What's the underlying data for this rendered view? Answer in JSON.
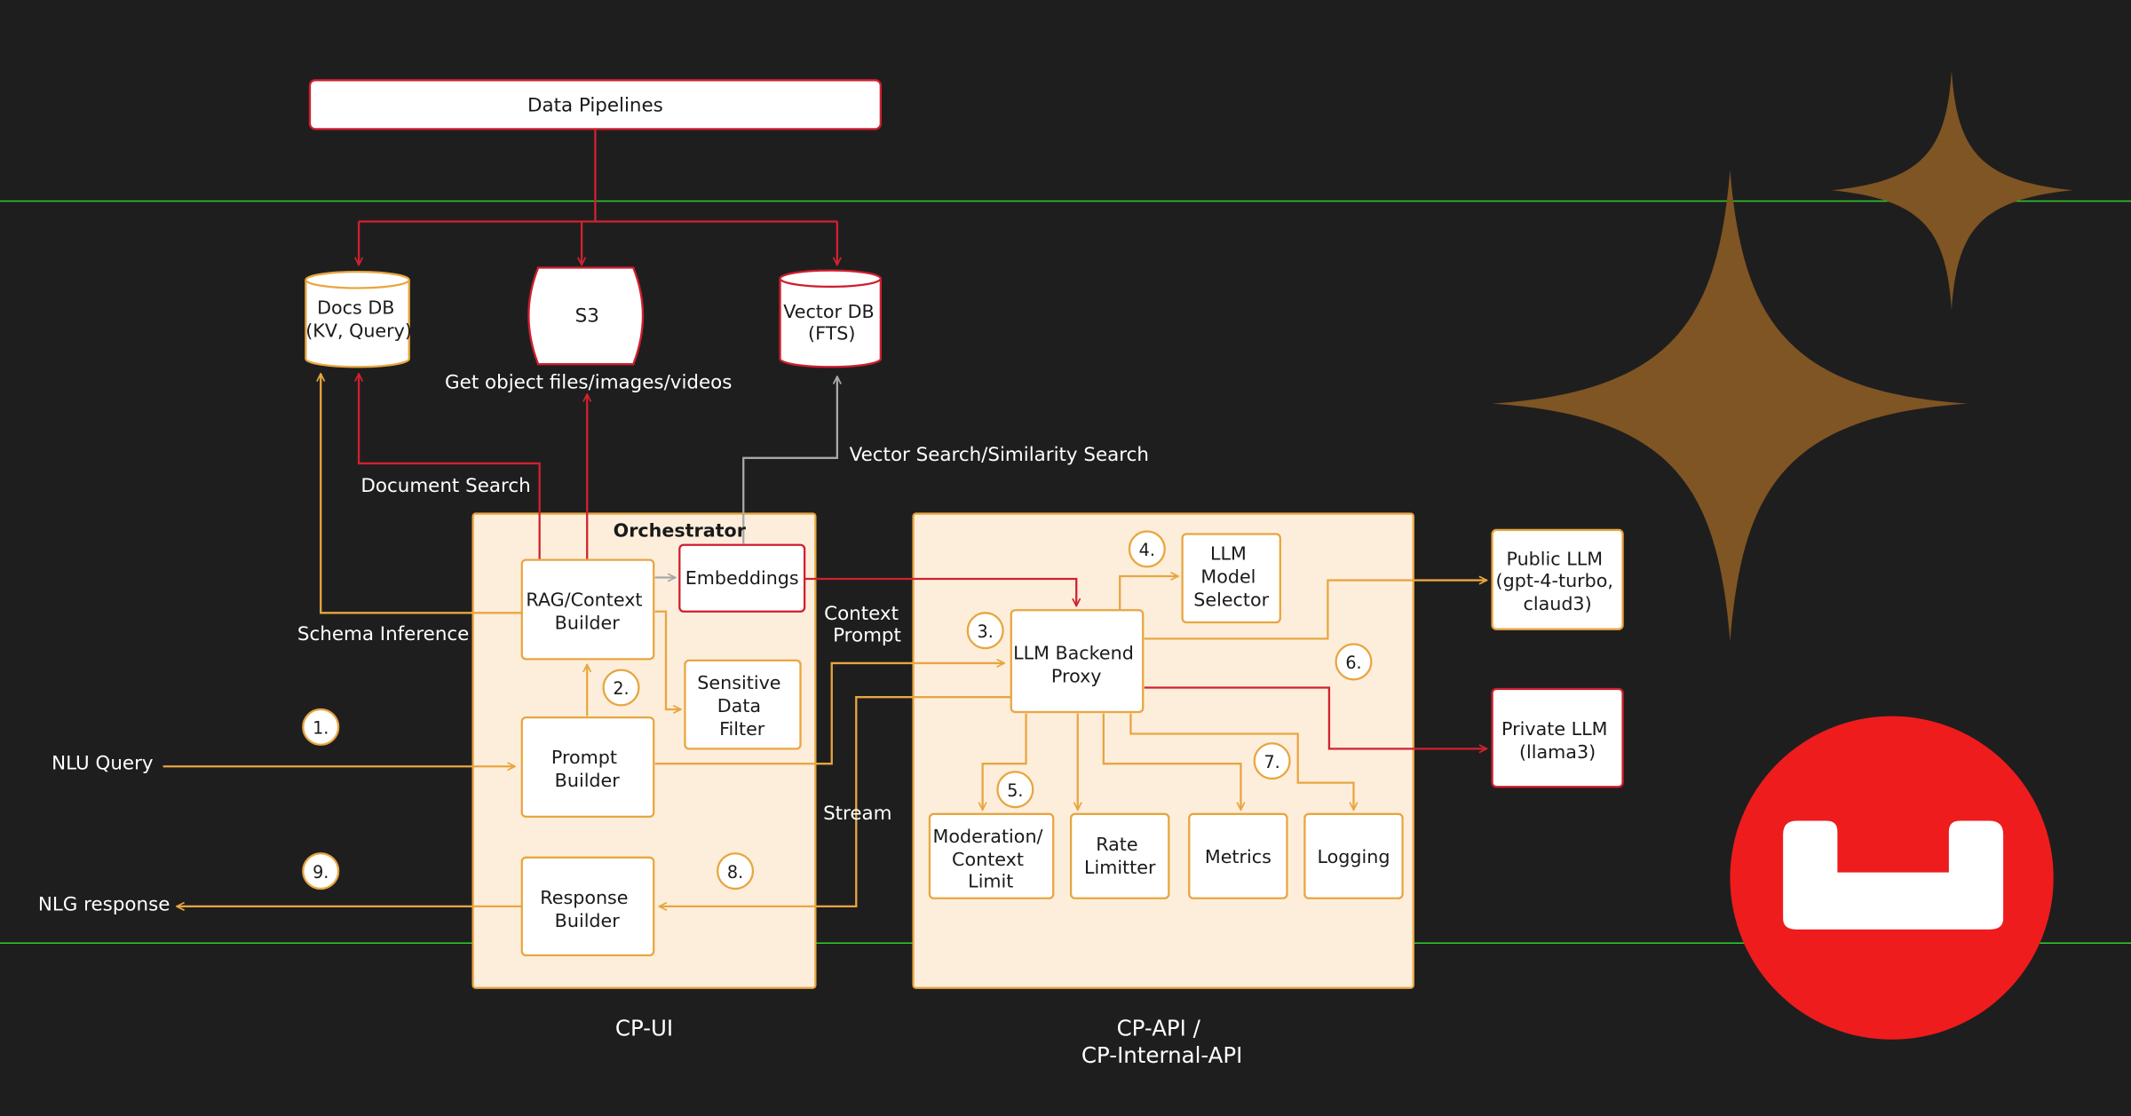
{
  "colors": {
    "background": "#1f1e1f",
    "box_fill": "#fdeedc",
    "box_border_orange": "#e8a640",
    "box_border_red": "#cf1f2e",
    "arrow_red": "#d0222e",
    "arrow_orange": "#e8a640",
    "arrow_gray": "#a8a8a8",
    "guide_green": "#2bd12b",
    "star_bronze": "#7f5523",
    "logo_red": "#ee1c1c"
  },
  "pipeline": {
    "data_pipelines": "Data Pipelines"
  },
  "stores": {
    "docs_db": [
      "Docs DB",
      "(KV, Query)"
    ],
    "s3": "S3",
    "vector_db": [
      "Vector DB",
      "(FTS)"
    ]
  },
  "edge_labels": {
    "get_objects": "Get object files/images/videos",
    "vector_search": "Vector Search/Similarity Search",
    "document_search": "Document Search",
    "schema_inference": "Schema Inference",
    "context_prompt": [
      "Context",
      "Prompt"
    ],
    "stream": "Stream",
    "nlu_query": "NLU Query",
    "nlg_response": "NLG response"
  },
  "cp_ui": {
    "orchestrator": "Orchestrator",
    "rag": [
      "RAG/Context",
      "Builder"
    ],
    "embeddings": "Embeddings",
    "sensitive": [
      "Sensitive",
      "Data",
      "Filter"
    ],
    "prompt": [
      "Prompt",
      "Builder"
    ],
    "response": [
      "Response",
      "Builder"
    ],
    "title": "CP-UI"
  },
  "cp_api": {
    "llm_model_selector": [
      "LLM",
      "Model",
      "Selector"
    ],
    "llm_backend_proxy": [
      "LLM Backend",
      "Proxy"
    ],
    "moderation": [
      "Moderation/",
      "Context",
      "Limit"
    ],
    "rate_limiter": [
      "Rate",
      "Limitter"
    ],
    "metrics": "Metrics",
    "logging": "Logging",
    "title": [
      "CP-API /",
      "CP-Internal-API"
    ]
  },
  "external": {
    "public_llm": [
      "Public LLM",
      "(gpt-4-turbo,",
      "claud3)"
    ],
    "private_llm": [
      "Private LLM",
      "(llama3)"
    ]
  },
  "steps": [
    "1.",
    "2.",
    "3.",
    "4.",
    "5.",
    "6.",
    "7.",
    "8.",
    "9."
  ],
  "icons": [
    "sparkle-star-large-icon",
    "sparkle-star-small-icon",
    "brand-logo-icon"
  ]
}
